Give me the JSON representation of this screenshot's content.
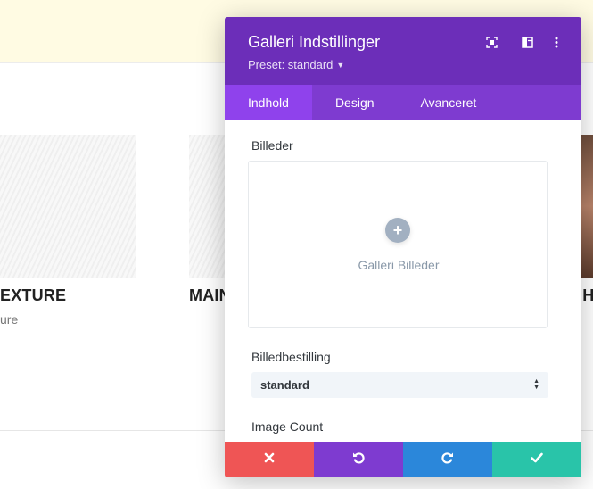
{
  "background": {
    "items": [
      {
        "title": "EXTURE",
        "subtitle": "ure"
      },
      {
        "title": "MAIN",
        "subtitle": ""
      },
      {
        "title": "IH",
        "subtitle": ""
      }
    ]
  },
  "modal": {
    "title": "Galleri Indstillinger",
    "preset": "Preset: standard",
    "header_icons": [
      "fullscreen-icon",
      "split-layout-icon",
      "more-vertical-icon"
    ],
    "tabs": [
      {
        "label": "Indhold",
        "active": true
      },
      {
        "label": "Design",
        "active": false
      },
      {
        "label": "Avanceret",
        "active": false
      }
    ],
    "images_label": "Billeder",
    "images_placeholder": "Galleri Billeder",
    "order_label": "Billedbestilling",
    "order_value": "standard",
    "count_label": "Image Count",
    "footer_icons": [
      "close-icon",
      "undo-icon",
      "redo-icon",
      "check-icon"
    ]
  },
  "colors": {
    "header": "#6c2eb9",
    "tabs": "#7e3bd0",
    "active_tab": "#8f42ec",
    "cancel": "#ef5555",
    "undo": "#7e3bd0",
    "redo": "#2b87da",
    "save": "#29c4a9"
  }
}
